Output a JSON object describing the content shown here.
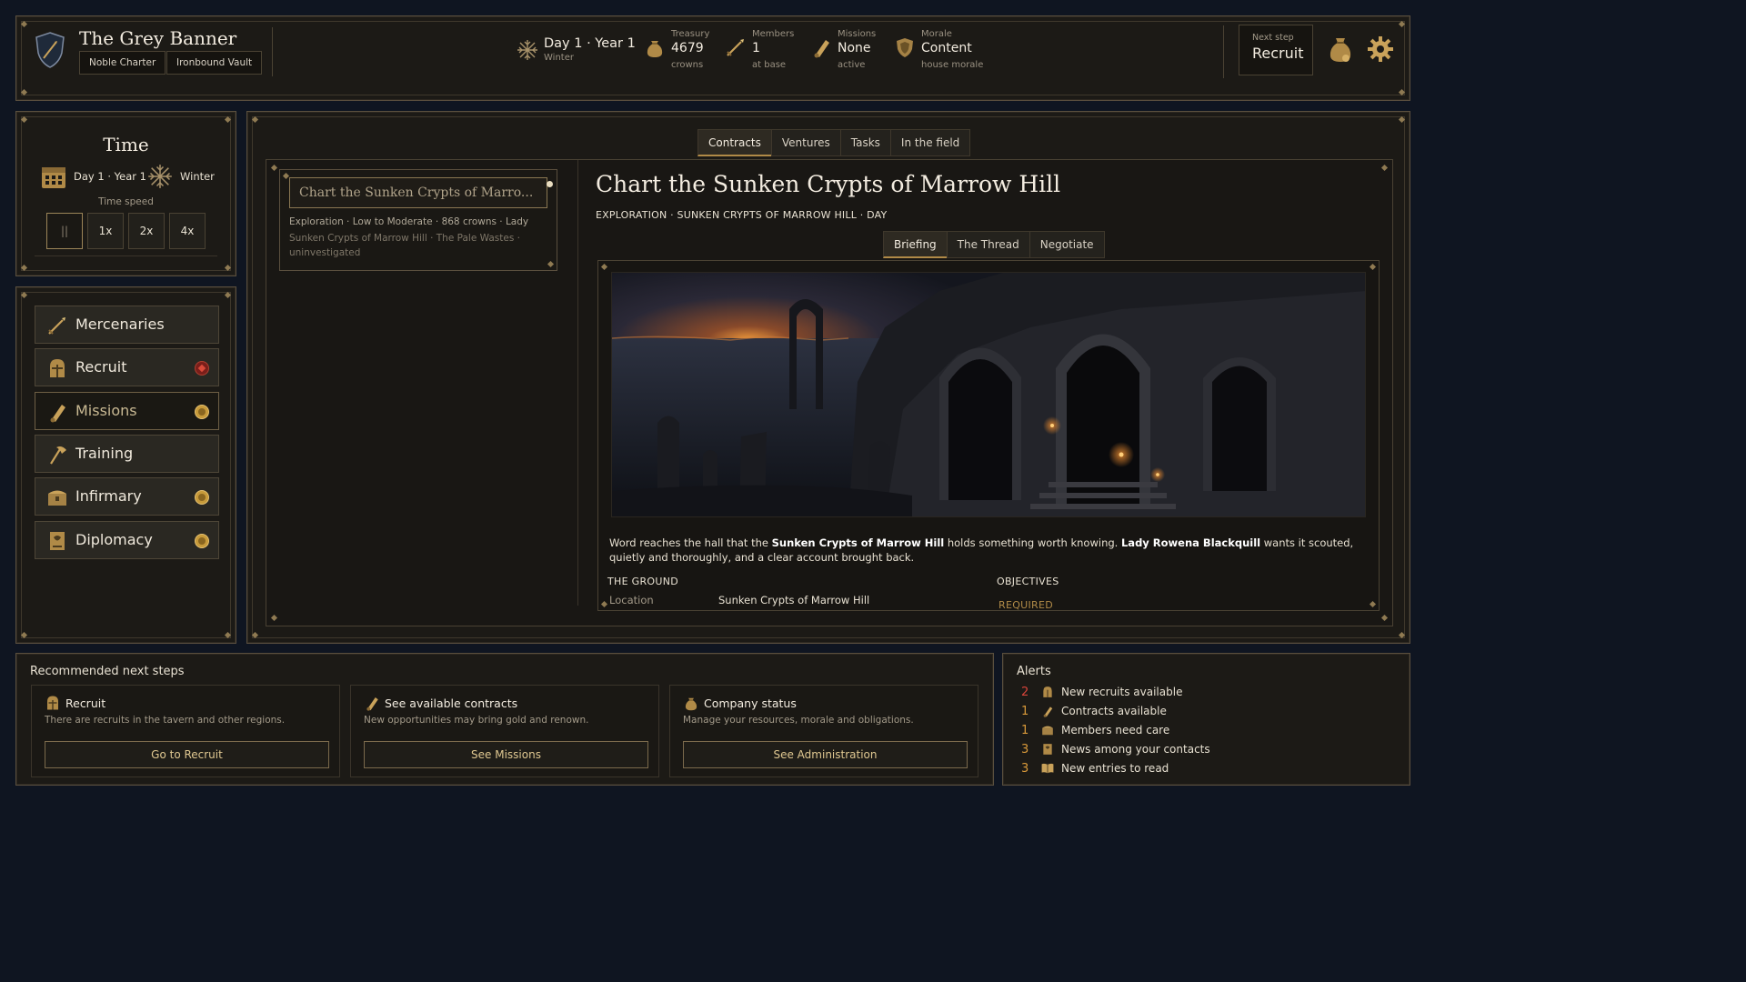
{
  "header": {
    "guild_name": "The Grey Banner",
    "tags": [
      "Noble Charter",
      "Ironbound Vault"
    ],
    "date_main": "Day 1 · Year 1",
    "date_sub": "Winter",
    "stats": [
      {
        "label": "Treasury",
        "value": "4679",
        "sub": "crowns",
        "icon": "coin-purse-icon"
      },
      {
        "label": "Members",
        "value": "1",
        "sub": "at base",
        "icon": "sword-icon"
      },
      {
        "label": "Missions",
        "value": "None",
        "sub": "active",
        "icon": "scroll-icon"
      },
      {
        "label": "Morale",
        "value": "Content",
        "sub": "house morale",
        "icon": "shield-crest-icon"
      }
    ],
    "next_step_label": "Next step",
    "next_step_value": "Recruit"
  },
  "time": {
    "title": "Time",
    "date": "Day 1 · Year 1",
    "season": "Winter",
    "speed_label": "Time speed",
    "speeds": [
      "||",
      "1x",
      "2x",
      "4x"
    ],
    "active_speed": "||"
  },
  "nav": [
    {
      "label": "Mercenaries",
      "icon": "sword-icon",
      "badge": "none"
    },
    {
      "label": "Recruit",
      "icon": "helmet-icon",
      "badge": "red"
    },
    {
      "label": "Missions",
      "icon": "scroll-icon",
      "badge": "gold",
      "active": true
    },
    {
      "label": "Training",
      "icon": "axe-icon",
      "badge": "none"
    },
    {
      "label": "Infirmary",
      "icon": "chest-icon",
      "badge": "gold"
    },
    {
      "label": "Diplomacy",
      "icon": "banner-icon",
      "badge": "gold"
    }
  ],
  "main": {
    "tabs": [
      "Contracts",
      "Ventures",
      "Tasks",
      "In the field"
    ],
    "active_tab": "Contracts",
    "contract": {
      "title": "Chart the Sunken Crypts of Marro...",
      "meta_line1": "Exploration · Low to Moderate · 868 crowns · Lady",
      "meta_line2": "Sunken Crypts of Marrow Hill · The Pale Wastes ·",
      "meta_line3": "uninvestigated"
    },
    "detail": {
      "title": "Chart the Sunken Crypts of Marrow Hill",
      "subtitle": "EXPLORATION · SUNKEN CRYPTS OF MARROW HILL · DAY",
      "subtabs": [
        "Briefing",
        "The Thread",
        "Negotiate"
      ],
      "active_subtab": "Briefing",
      "brief_1": "Word reaches the hall that the ",
      "brief_place": "Sunken Crypts of Marrow Hill",
      "brief_2": " holds something worth knowing. ",
      "brief_person": "Lady Rowena Blackquill",
      "brief_3": " wants it scouted, quietly and thoroughly, and a clear account brought back.",
      "ground_heading": "THE GROUND",
      "objectives_heading": "OBJECTIVES",
      "location_label": "Location",
      "location_value": "Sunken Crypts of Marrow Hill",
      "required_label": "REQUIRED"
    }
  },
  "recommended": {
    "heading": "Recommended next steps",
    "items": [
      {
        "title": "Recruit",
        "desc": "There are recruits in the tavern and other regions.",
        "button": "Go to Recruit",
        "icon": "helmet-icon"
      },
      {
        "title": "See available contracts",
        "desc": "New opportunities may bring gold and renown.",
        "button": "See Missions",
        "icon": "scroll-icon"
      },
      {
        "title": "Company status",
        "desc": "Manage your resources, morale and obligations.",
        "button": "See Administration",
        "icon": "coin-purse-icon"
      }
    ]
  },
  "alerts": {
    "heading": "Alerts",
    "items": [
      {
        "count": "2",
        "text": "New recruits available",
        "icon": "helmet-icon",
        "color": "#d7443a"
      },
      {
        "count": "1",
        "text": "Contracts available",
        "icon": "scroll-icon",
        "color": "#d99a3a"
      },
      {
        "count": "1",
        "text": "Members need care",
        "icon": "chest-icon",
        "color": "#d99a3a"
      },
      {
        "count": "3",
        "text": "News among your contacts",
        "icon": "banner-icon",
        "color": "#d99a3a"
      },
      {
        "count": "3",
        "text": "New entries to read",
        "icon": "book-icon",
        "color": "#d99a3a"
      }
    ]
  },
  "colors": {
    "accent_gold": "#b08a47",
    "panel_bg": "#1c1a16",
    "page_bg": "#0f1521"
  }
}
